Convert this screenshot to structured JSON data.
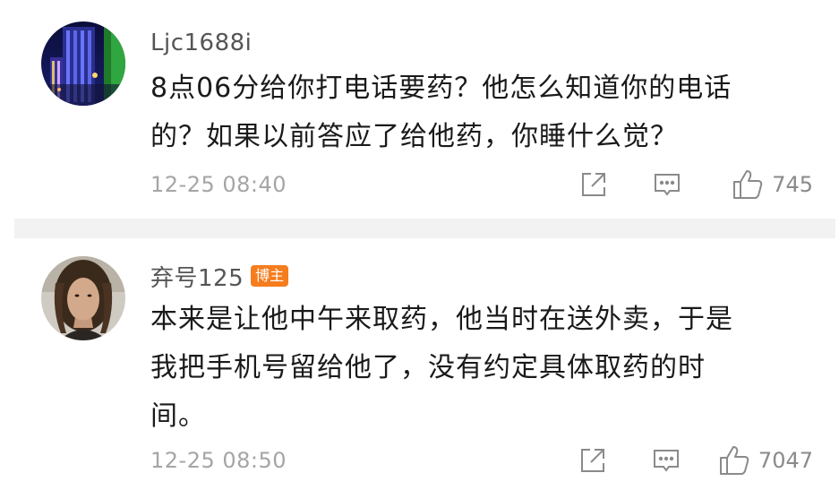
{
  "comments": [
    {
      "username": "Ljc1688i",
      "badge": "",
      "text_lines": [
        "8点06分给你打电话要药？他怎么知道你的电话",
        "的？如果以前答应了给他药，你睡什么觉？"
      ],
      "time": "12-25 08:40",
      "likes": "745",
      "avatar_icon": "city-night-avatar",
      "share_icon": "share-icon",
      "reply_icon": "comment-icon",
      "like_icon": "thumbs-up-icon"
    },
    {
      "username": "弃号125",
      "badge": "博主",
      "text_lines": [
        "本来是让他中午来取药，他当时在送外卖，于是",
        "我把手机号留给他了，没有约定具体取药的时",
        "间。"
      ],
      "time": "12-25 08:50",
      "likes": "7047",
      "avatar_icon": "person-avatar",
      "share_icon": "share-icon",
      "reply_icon": "comment-icon",
      "like_icon": "thumbs-up-icon"
    }
  ],
  "colors": {
    "badge": "#f57d1e",
    "separator": "#f2f2f2",
    "meta_text": "#a5a5a5",
    "icon": "#8a8a8a"
  }
}
